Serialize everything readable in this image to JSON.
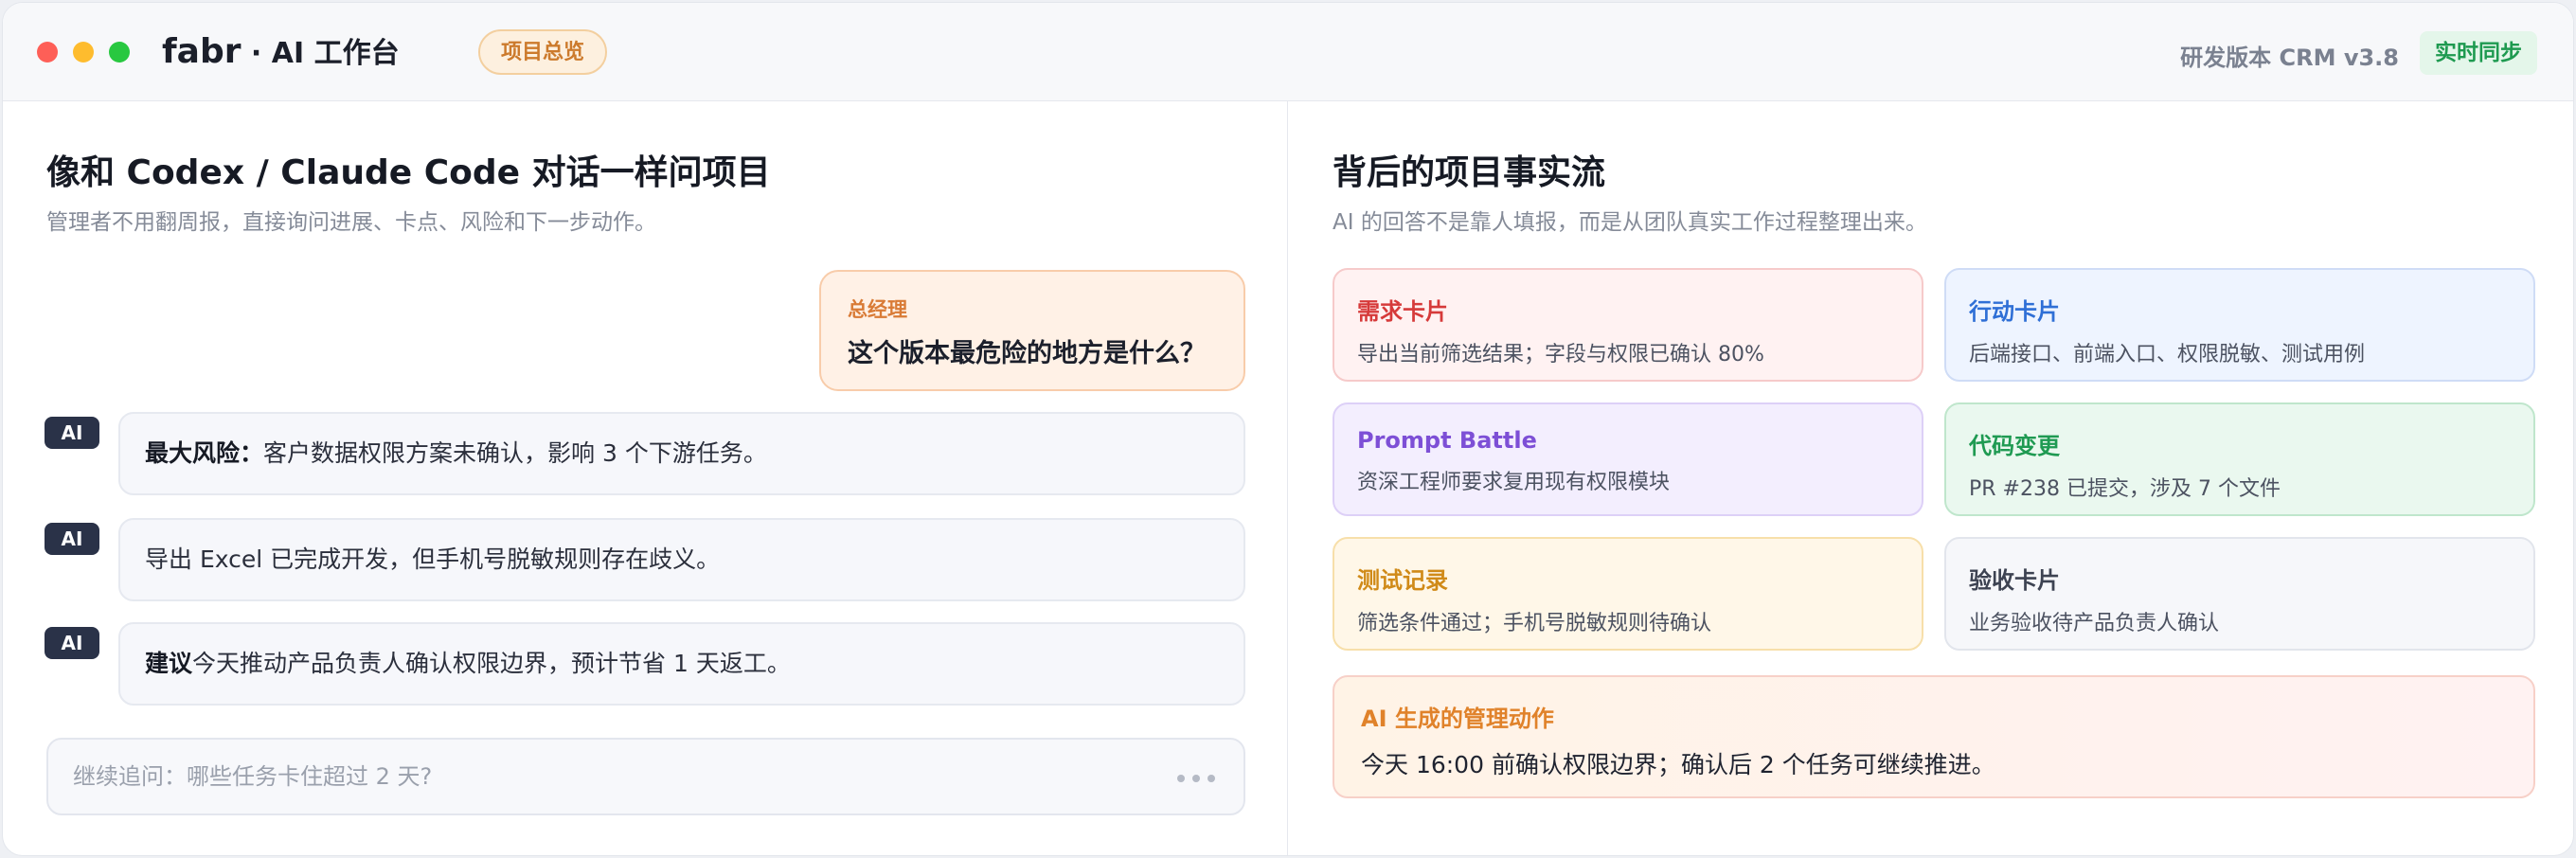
{
  "header": {
    "app_name": "fabr",
    "app_suffix": " · AI 工作台",
    "tab_label": "项目总览",
    "version": "研发版本 CRM v3.8",
    "sync_label": "实时同步"
  },
  "chat_panel": {
    "title": "像和 Codex / Claude Code 对话一样问项目",
    "subtitle": "管理者不用翻周报，直接询问进展、卡点、风险和下一步动作。",
    "user_message": {
      "role": "总经理",
      "text": "这个版本最危险的地方是什么？"
    },
    "ai_tag": "AI",
    "ai_messages": [
      {
        "bold": "最大风险：",
        "text": "客户数据权限方案未确认，影响 3 个下游任务。"
      },
      {
        "bold": "",
        "text": "导出 Excel 已完成开发，但手机号脱敏规则存在歧义。"
      },
      {
        "bold": "建议",
        "text": "今天推动产品负责人确认权限边界，预计节省 1 天返工。"
      }
    ],
    "followup_placeholder": "继续追问：哪些任务卡住超过 2 天?"
  },
  "facts_panel": {
    "title": "背后的项目事实流",
    "subtitle": "AI 的回答不是靠人填报，而是从团队真实工作过程整理出来。",
    "cards": [
      {
        "title": "需求卡片",
        "desc": "导出当前筛选结果；字段与权限已确认 80%",
        "color": "#d63a3a"
      },
      {
        "title": "行动卡片",
        "desc": "后端接口、前端入口、权限脱敏、测试用例",
        "color": "#2f6fd6"
      },
      {
        "title": "Prompt Battle",
        "desc": "资深工程师要求复用现有权限模块",
        "color": "#7d4fd6"
      },
      {
        "title": "代码变更",
        "desc": "PR #238 已提交，涉及 7 个文件",
        "color": "#1f9a52"
      },
      {
        "title": "测试记录",
        "desc": "筛选条件通过；手机号脱敏规则待确认",
        "color": "#d08a18"
      },
      {
        "title": "验收卡片",
        "desc": "业务验收待产品负责人确认",
        "color": "#3d4352"
      }
    ],
    "action": {
      "title": "AI 生成的管理动作",
      "desc": "今天 16:00 前确认权限边界；确认后 2 个任务可继续推进。"
    }
  }
}
